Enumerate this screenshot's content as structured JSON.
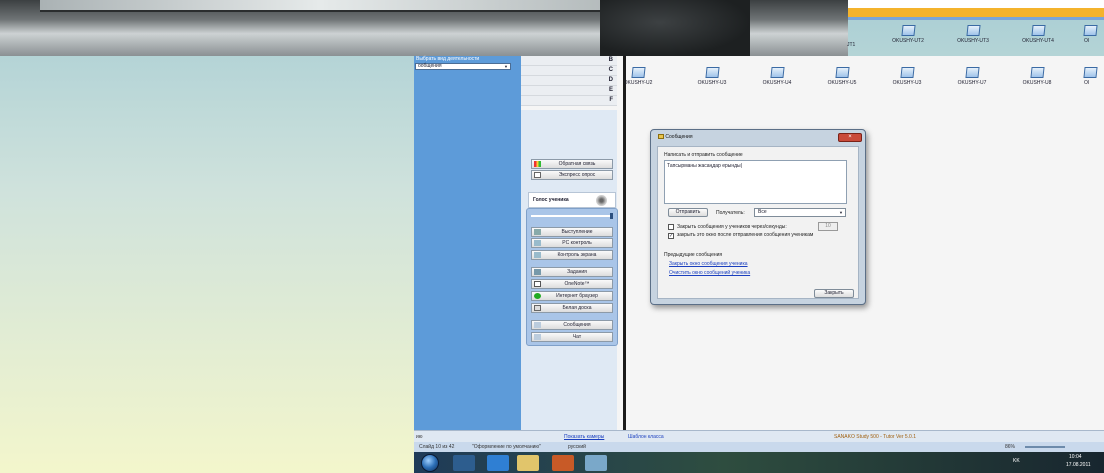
{
  "activity": {
    "label": "Выбрать вид деятельности",
    "selected": "ообщения"
  },
  "group_rows": [
    "B",
    "C",
    "D",
    "E",
    "F"
  ],
  "side_buttons": [
    {
      "label": "Обратная связь",
      "icon": "feedback-icon"
    },
    {
      "label": "Экспресс опрос",
      "icon": "poll-icon"
    }
  ],
  "voice": {
    "title": "Голос ученика"
  },
  "voice_buttons": [
    {
      "label": "Выступление",
      "icon": "speech-icon"
    },
    {
      "label": "PC контроль",
      "icon": "pc-control-icon"
    },
    {
      "label": "Контроль экрана",
      "icon": "screen-control-icon"
    },
    {
      "label": "Задания",
      "icon": "tasks-icon"
    },
    {
      "label": "OneNote™",
      "icon": "onenote-icon"
    },
    {
      "label": "Интернет браузер",
      "icon": "browser-icon"
    },
    {
      "label": "Белая доска",
      "icon": "whiteboard-icon"
    },
    {
      "label": "Сообщения",
      "icon": "messages-icon"
    },
    {
      "label": "Чат",
      "icon": "chat-icon"
    }
  ],
  "computers_row1": [
    "JT1",
    "OKUSHY-UT2",
    "OKUSHY-UT3",
    "OKUSHY-UT4",
    "OI"
  ],
  "computers_row2": [
    "OKUSHY-U2",
    "OKUSHY-U3",
    "OKUSHY-U4",
    "OKUSHY-U5",
    "OKUSHY-U3",
    "OKUSHY-U7",
    "OKUSHY-U8",
    "OI"
  ],
  "dialog": {
    "title": "Сообщения",
    "compose_label": "Написать и отправить сообщение",
    "message": "Тапсырманы жасаңдар ерынды|",
    "send": "Отправить",
    "recipient_label": "Получатель:",
    "recipient": "Все",
    "opt_close_after": "Закрыть сообщения у учеников через/секунды:",
    "opt_close_after_value": "10",
    "opt_close_window": "закрыть это окно после отправления сообщения ученикам",
    "previous_label": "Предыдущие сообщения",
    "link_close": "Закрыть окно сообщения ученика",
    "link_clear": "Очистить окно сообщений ученика",
    "close_button": "Закрыть"
  },
  "status": {
    "left": "ию",
    "link": "Показать камеры",
    "class_template": "Шаблон класса",
    "product": "SANAKO Study 500 - Tutor Ver 5.0.1"
  },
  "ppt": {
    "slide": "Слайд 10 из 42",
    "theme": "\"Оформление по умолчанию\"",
    "lang": "русский",
    "zoom": "86%"
  },
  "tray": {
    "lang": "KK",
    "time": "10:04",
    "date": "17.08.2011"
  },
  "colors": {
    "accent_orange": "#f4b32c",
    "panel_blue": "#5d9bd9"
  }
}
